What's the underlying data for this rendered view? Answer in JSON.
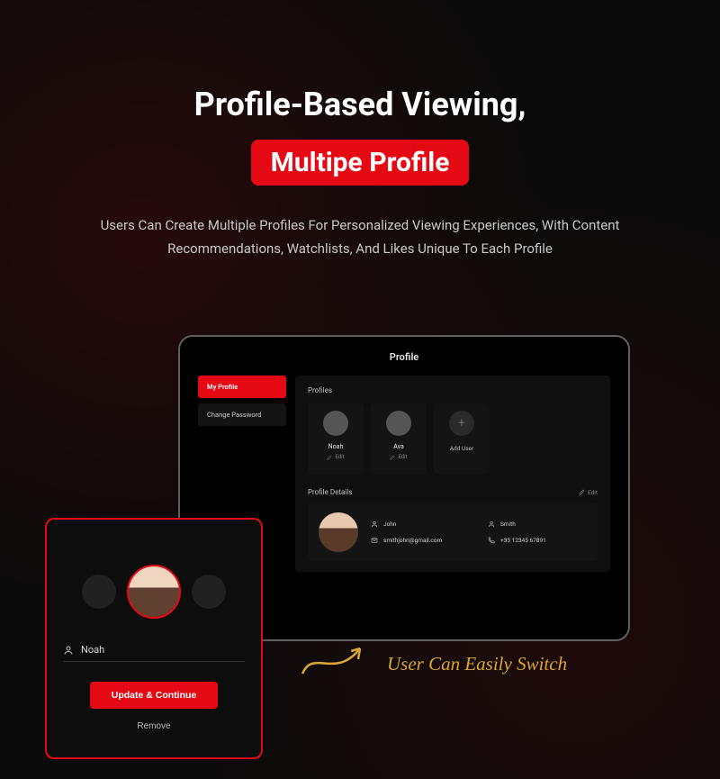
{
  "hero": {
    "title": "Profile-Based Viewing,",
    "badge": "Multipe Profile",
    "subtitle": "Users Can Create Multiple Profiles For Personalized Viewing Experiences, With Content Recommendations, Watchlists, And Likes Unique To Each Profile"
  },
  "tablet": {
    "title": "Profile",
    "sidebar": {
      "my_profile": "My Profile",
      "change_password": "Change Password"
    },
    "profiles_label": "Profiles",
    "profiles": [
      {
        "name": "Noah",
        "edit": "Edit"
      },
      {
        "name": "Ava",
        "edit": "Edit"
      }
    ],
    "add_user": "Add User",
    "details_label": "Profile Details",
    "details_edit": "Edit",
    "details": {
      "first_name": "John",
      "last_name": "Smith",
      "email": "smithjohn@gmail.com",
      "phone": "+33 12345 67891"
    }
  },
  "phone": {
    "name": "Noah",
    "update_btn": "Update & Continue",
    "remove_btn": "Remove"
  },
  "callout": "User Can Easily Switch",
  "colors": {
    "accent": "#e50914",
    "callout": "#d9a830"
  }
}
